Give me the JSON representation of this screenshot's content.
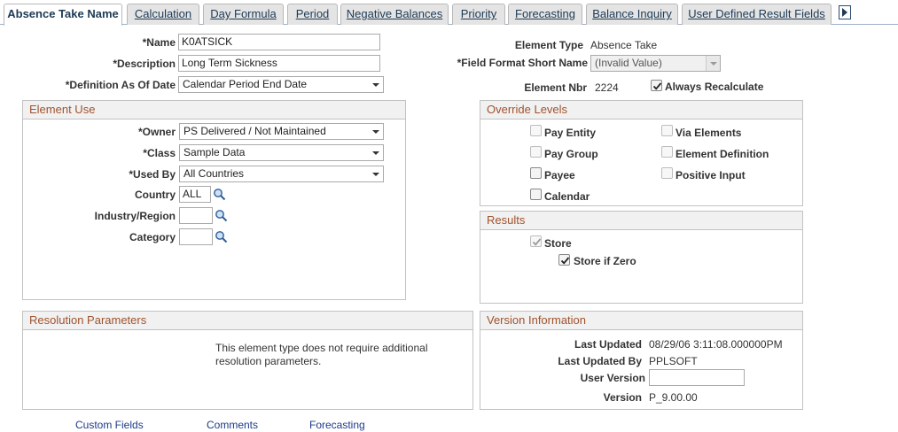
{
  "tabs": [
    {
      "label": "Absence Take Name",
      "active": true
    },
    {
      "label": "Calculation"
    },
    {
      "label": "Day Formula"
    },
    {
      "label": "Period"
    },
    {
      "label": "Negative Balances"
    },
    {
      "label": "Priority"
    },
    {
      "label": "Forecasting"
    },
    {
      "label": "Balance Inquiry"
    },
    {
      "label": "User Defined Result Fields"
    }
  ],
  "header": {
    "name_label": "*Name",
    "name_value": "K0ATSICK",
    "description_label": "*Description",
    "description_value": "Long Term Sickness",
    "definition_label": "*Definition As Of Date",
    "definition_value": "Calendar Period End Date",
    "element_type_label": "Element Type",
    "element_type_value": "Absence Take",
    "field_format_label": "*Field Format Short Name",
    "field_format_value": "(Invalid Value)",
    "element_nbr_label": "Element Nbr",
    "element_nbr_value": "2224",
    "always_recalculate_label": "Always Recalculate",
    "always_recalculate_checked": true
  },
  "element_use": {
    "title": "Element Use",
    "owner_label": "*Owner",
    "owner_value": "PS Delivered / Not Maintained",
    "class_label": "*Class",
    "class_value": "Sample Data",
    "used_by_label": "*Used By",
    "used_by_value": "All Countries",
    "country_label": "Country",
    "country_value": "ALL",
    "industry_label": "Industry/Region",
    "industry_value": "",
    "category_label": "Category",
    "category_value": ""
  },
  "override_levels": {
    "title": "Override Levels",
    "items": [
      {
        "label": "Pay Entity",
        "checked": false
      },
      {
        "label": "Via Elements",
        "checked": false
      },
      {
        "label": "Pay Group",
        "checked": false
      },
      {
        "label": "Element Definition",
        "checked": false
      },
      {
        "label": "Payee",
        "checked": false
      },
      {
        "label": "Positive Input",
        "checked": false
      },
      {
        "label": "Calendar",
        "checked": false
      }
    ]
  },
  "results": {
    "title": "Results",
    "store_label": "Store",
    "store_checked": true,
    "store_if_zero_label": "Store if Zero",
    "store_if_zero_checked": true
  },
  "resolution": {
    "title": "Resolution Parameters",
    "note_line1": "This element type does not require additional",
    "note_line2": "resolution parameters."
  },
  "version": {
    "title": "Version Information",
    "last_updated_label": "Last Updated",
    "last_updated_value": "08/29/06  3:11:08.000000PM",
    "last_updated_by_label": "Last Updated By",
    "last_updated_by_value": "PPLSOFT",
    "user_version_label": "User Version",
    "user_version_value": "",
    "version_label": "Version",
    "version_value": "P_9.00.00"
  },
  "footer_links": {
    "custom_fields": "Custom Fields",
    "comments": "Comments",
    "forecasting": "Forecasting"
  }
}
